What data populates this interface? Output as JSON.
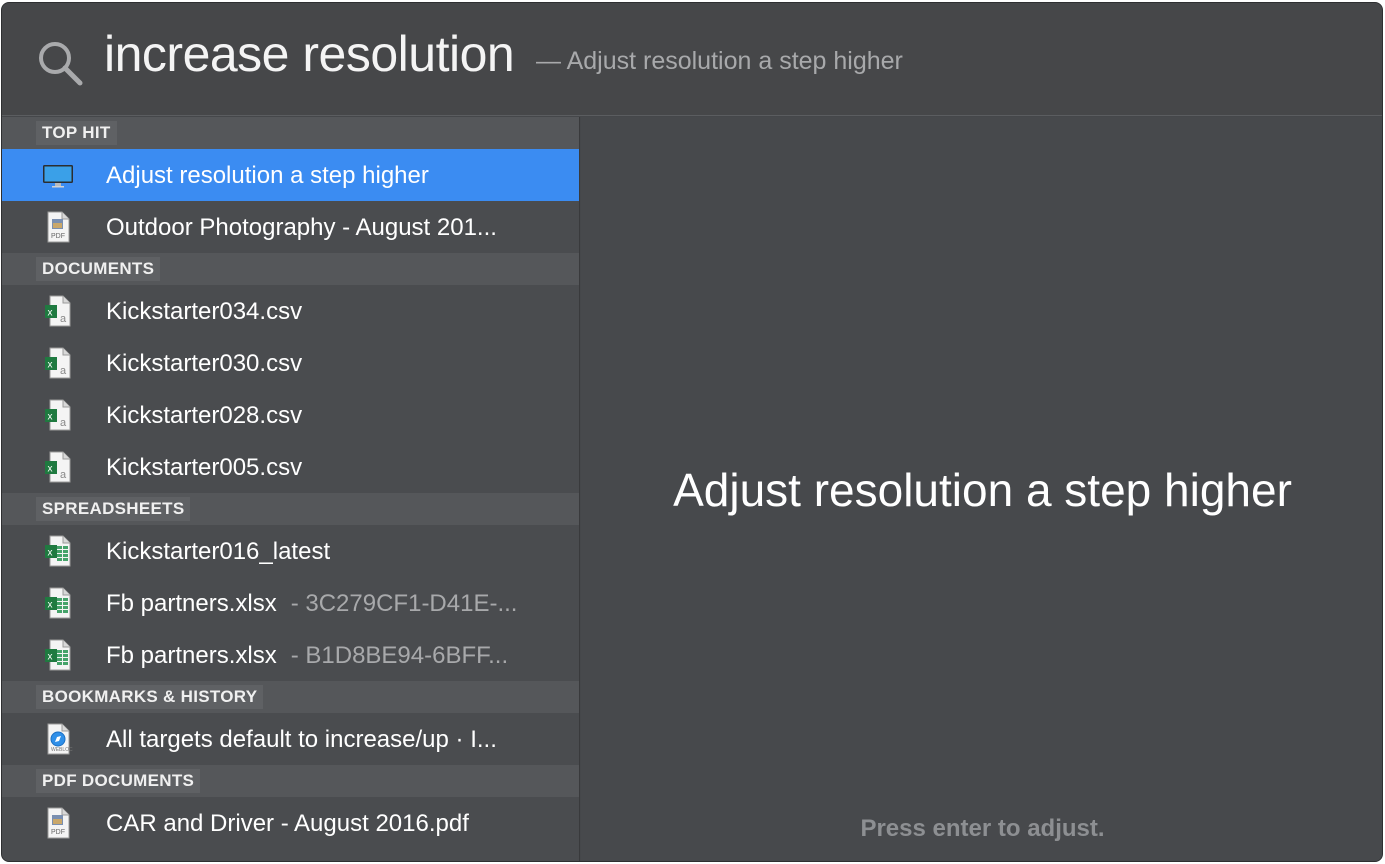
{
  "search": {
    "query": "increase resolution",
    "completion": "— Adjust resolution a step higher"
  },
  "sections": [
    {
      "header": "TOP HIT",
      "items": [
        {
          "label": "Adjust resolution a step higher",
          "sub": "",
          "icon": "display-icon",
          "selected": true
        },
        {
          "label": "Outdoor Photography - August 201...",
          "sub": "",
          "icon": "pdf-file-icon",
          "selected": false
        }
      ]
    },
    {
      "header": "DOCUMENTS",
      "items": [
        {
          "label": "Kickstarter034.csv",
          "sub": "",
          "icon": "csv-file-icon",
          "selected": false
        },
        {
          "label": "Kickstarter030.csv",
          "sub": "",
          "icon": "csv-file-icon",
          "selected": false
        },
        {
          "label": "Kickstarter028.csv",
          "sub": "",
          "icon": "csv-file-icon",
          "selected": false
        },
        {
          "label": "Kickstarter005.csv",
          "sub": "",
          "icon": "csv-file-icon",
          "selected": false
        }
      ]
    },
    {
      "header": "SPREADSHEETS",
      "items": [
        {
          "label": "Kickstarter016_latest",
          "sub": "",
          "icon": "excel-file-icon",
          "selected": false
        },
        {
          "label": "Fb partners.xlsx",
          "sub": "- 3C279CF1-D41E-...",
          "icon": "excel-file-icon",
          "selected": false
        },
        {
          "label": "Fb partners.xlsx",
          "sub": "- B1D8BE94-6BFF...",
          "icon": "excel-file-icon",
          "selected": false
        }
      ]
    },
    {
      "header": "BOOKMARKS & HISTORY",
      "items": [
        {
          "label": "All targets default to increase/up · I...",
          "sub": "",
          "icon": "safari-webloc-icon",
          "selected": false
        }
      ]
    },
    {
      "header": "PDF DOCUMENTS",
      "items": [
        {
          "label": "CAR and Driver - August 2016.pdf",
          "sub": "",
          "icon": "pdf-file-icon",
          "selected": false
        }
      ]
    }
  ],
  "preview": {
    "title": "Adjust resolution a step higher",
    "hint": "Press enter to adjust."
  },
  "colors": {
    "selection": "#3b8cf2",
    "background": "#45474a",
    "section_header": "#55575a"
  }
}
